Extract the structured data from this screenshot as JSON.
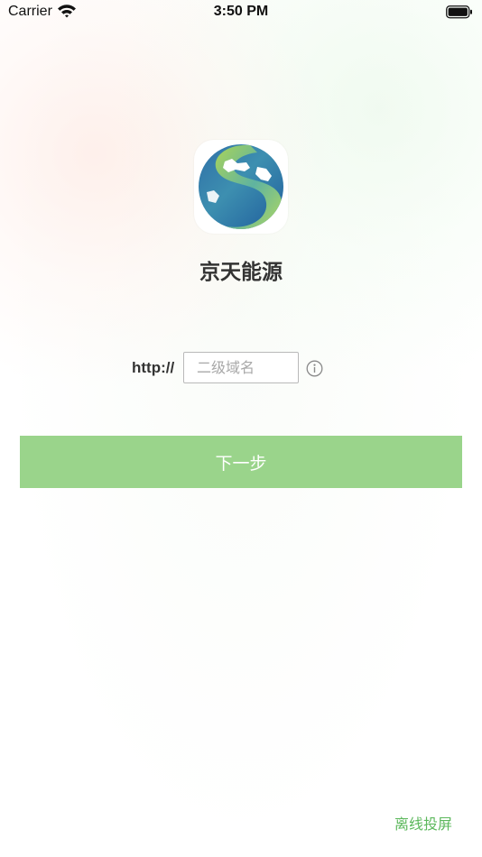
{
  "status_bar": {
    "carrier": "Carrier",
    "time": "3:50 PM"
  },
  "app": {
    "name": "京天能源"
  },
  "domain_form": {
    "prefix": "http://",
    "placeholder": "二级域名",
    "value": ""
  },
  "next_button": {
    "label": "下一步"
  },
  "offline_link": {
    "label": "离线投屏"
  },
  "colors": {
    "accent": "#9ad48b",
    "link": "#5cb85c",
    "text": "#333333"
  },
  "icons": [
    "wifi-icon",
    "battery-icon",
    "app-logo-icon",
    "info-icon"
  ]
}
